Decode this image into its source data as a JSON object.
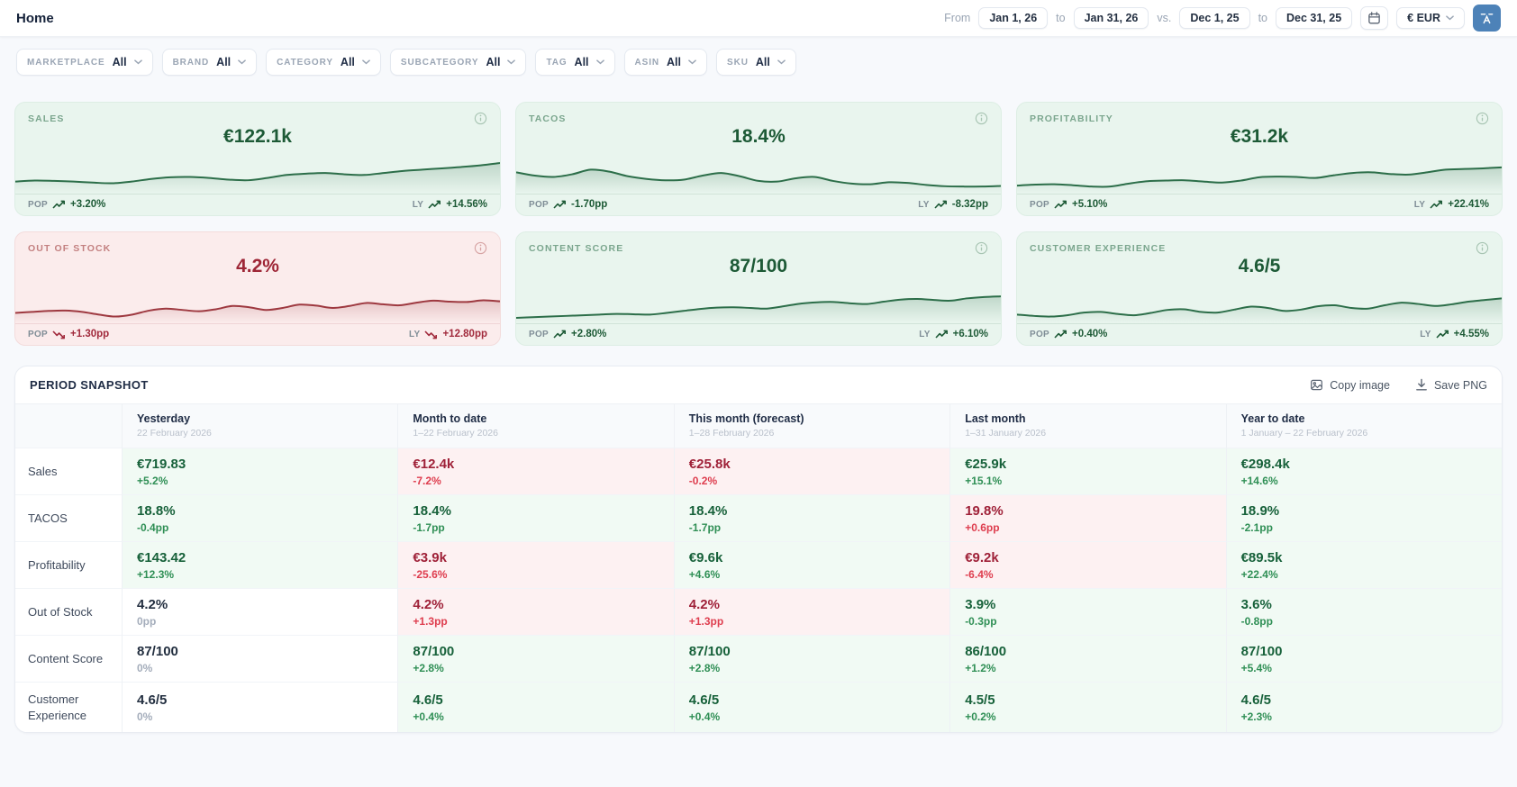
{
  "page": {
    "title": "Home"
  },
  "topbar": {
    "from_label": "From",
    "to_label": "to",
    "vs_label": "vs.",
    "date_start": "Jan 1, 26",
    "date_end": "Jan 31, 26",
    "compare_start": "Dec 1, 25",
    "compare_end": "Dec 31, 25",
    "currency": "€ EUR"
  },
  "colors": {
    "accent_blue": "#4d82b8",
    "positive_dark": "#17613a",
    "positive": "#2f8f55",
    "negative_dark": "#9f2138",
    "negative": "#de3d4e"
  },
  "filters": [
    {
      "label": "MARKETPLACE",
      "value": "All"
    },
    {
      "label": "BRAND",
      "value": "All"
    },
    {
      "label": "CATEGORY",
      "value": "All"
    },
    {
      "label": "SUBCATEGORY",
      "value": "All"
    },
    {
      "label": "TAG",
      "value": "All"
    },
    {
      "label": "ASIN",
      "value": "All"
    },
    {
      "label": "SKU",
      "value": "All"
    }
  ],
  "kpi_labels": {
    "pop": "POP",
    "ly": "LY"
  },
  "kpi_cards": [
    {
      "title": "SALES",
      "value": "€122.1k",
      "pop": "+3.20%",
      "ly": "+14.56%",
      "tone": "green",
      "trend_icon": "trending-up",
      "line_color": "#2c6e49",
      "sparkline": [
        30,
        33,
        32,
        30,
        27,
        25,
        30,
        38,
        43,
        44,
        41,
        36,
        34,
        41,
        50,
        54,
        56,
        52,
        50,
        56,
        62,
        66,
        70,
        74,
        79,
        86
      ]
    },
    {
      "title": "TACOS",
      "value": "18.4%",
      "pop": "-1.70pp",
      "ly": "-8.32pp",
      "tone": "green",
      "trend_icon": "trending-up",
      "line_color": "#2c6e49",
      "sparkline": [
        58,
        48,
        44,
        52,
        66,
        60,
        46,
        38,
        34,
        36,
        48,
        56,
        46,
        32,
        30,
        40,
        44,
        32,
        24,
        22,
        28,
        26,
        20,
        16,
        15,
        15,
        17
      ]
    },
    {
      "title": "PROFITABILITY",
      "value": "€31.2k",
      "pop": "+5.10%",
      "ly": "+22.41%",
      "tone": "green",
      "trend_icon": "trending-up",
      "line_color": "#2c6e49",
      "sparkline": [
        18,
        21,
        22,
        19,
        15,
        15,
        24,
        31,
        33,
        34,
        30,
        27,
        33,
        43,
        45,
        44,
        41,
        49,
        56,
        58,
        53,
        51,
        58,
        66,
        68,
        70,
        73
      ]
    },
    {
      "title": "OUT OF STOCK",
      "value": "4.2%",
      "pop": "+1.30pp",
      "ly": "+12.80pp",
      "tone": "red",
      "trend_icon": "trending-down",
      "line_color": "#9e3940",
      "sparkline": [
        25,
        28,
        31,
        32,
        28,
        20,
        14,
        20,
        32,
        38,
        34,
        30,
        36,
        46,
        42,
        34,
        40,
        50,
        47,
        40,
        46,
        55,
        51,
        48,
        56,
        62,
        59,
        58,
        63,
        60
      ]
    },
    {
      "title": "CONTENT SCORE",
      "value": "87/100",
      "pop": "+2.80%",
      "ly": "+6.10%",
      "tone": "green",
      "trend_icon": "trending-up",
      "line_color": "#2c6e49",
      "sparkline": [
        10,
        12,
        14,
        16,
        18,
        20,
        22,
        21,
        20,
        25,
        31,
        37,
        41,
        42,
        40,
        38,
        45,
        53,
        57,
        58,
        54,
        52,
        59,
        65,
        67,
        64,
        62,
        69,
        73,
        75
      ]
    },
    {
      "title": "CUSTOMER EXPERIENCE",
      "value": "4.6/5",
      "pop": "+0.40%",
      "ly": "+4.55%",
      "tone": "green",
      "trend_icon": "trending-up",
      "line_color": "#2c6e49",
      "sparkline": [
        20,
        16,
        14,
        18,
        26,
        28,
        22,
        18,
        25,
        34,
        36,
        28,
        26,
        35,
        44,
        40,
        31,
        35,
        45,
        48,
        40,
        38,
        48,
        56,
        52,
        46,
        51,
        59,
        64,
        69
      ]
    }
  ],
  "snapshot": {
    "title": "PERIOD SNAPSHOT",
    "copy_image_label": "Copy image",
    "save_png_label": "Save PNG",
    "columns": [
      {
        "label": "Yesterday",
        "range": "22 February 2026"
      },
      {
        "label": "Month to date",
        "range": "1–22 February 2026"
      },
      {
        "label": "This month (forecast)",
        "range": "1–28 February 2026"
      },
      {
        "label": "Last month",
        "range": "1–31 January 2026"
      },
      {
        "label": "Year to date",
        "range": "1 January – 22 February 2026"
      }
    ],
    "rows": [
      {
        "label": "Sales",
        "cells": [
          {
            "value": "€719.83",
            "delta": "+5.2%",
            "tone": "up"
          },
          {
            "value": "€12.4k",
            "delta": "-7.2%",
            "tone": "down"
          },
          {
            "value": "€25.8k",
            "delta": "-0.2%",
            "tone": "down"
          },
          {
            "value": "€25.9k",
            "delta": "+15.1%",
            "tone": "up"
          },
          {
            "value": "€298.4k",
            "delta": "+14.6%",
            "tone": "up"
          }
        ]
      },
      {
        "label": "TACOS",
        "cells": [
          {
            "value": "18.8%",
            "delta": "-0.4pp",
            "tone": "up"
          },
          {
            "value": "18.4%",
            "delta": "-1.7pp",
            "tone": "up"
          },
          {
            "value": "18.4%",
            "delta": "-1.7pp",
            "tone": "up"
          },
          {
            "value": "19.8%",
            "delta": "+0.6pp",
            "tone": "down"
          },
          {
            "value": "18.9%",
            "delta": "-2.1pp",
            "tone": "up"
          }
        ]
      },
      {
        "label": "Profitability",
        "cells": [
          {
            "value": "€143.42",
            "delta": "+12.3%",
            "tone": "up"
          },
          {
            "value": "€3.9k",
            "delta": "-25.6%",
            "tone": "down"
          },
          {
            "value": "€9.6k",
            "delta": "+4.6%",
            "tone": "up"
          },
          {
            "value": "€9.2k",
            "delta": "-6.4%",
            "tone": "down"
          },
          {
            "value": "€89.5k",
            "delta": "+22.4%",
            "tone": "up"
          }
        ]
      },
      {
        "label": "Out of Stock",
        "cells": [
          {
            "value": "4.2%",
            "delta": "0pp",
            "tone": "flat"
          },
          {
            "value": "4.2%",
            "delta": "+1.3pp",
            "tone": "down"
          },
          {
            "value": "4.2%",
            "delta": "+1.3pp",
            "tone": "down"
          },
          {
            "value": "3.9%",
            "delta": "-0.3pp",
            "tone": "up"
          },
          {
            "value": "3.6%",
            "delta": "-0.8pp",
            "tone": "up"
          }
        ]
      },
      {
        "label": "Content Score",
        "cells": [
          {
            "value": "87/100",
            "delta": "0%",
            "tone": "flat"
          },
          {
            "value": "87/100",
            "delta": "+2.8%",
            "tone": "up"
          },
          {
            "value": "87/100",
            "delta": "+2.8%",
            "tone": "up"
          },
          {
            "value": "86/100",
            "delta": "+1.2%",
            "tone": "up"
          },
          {
            "value": "87/100",
            "delta": "+5.4%",
            "tone": "up"
          }
        ]
      },
      {
        "label": "Customer Experience",
        "cells": [
          {
            "value": "4.6/5",
            "delta": "0%",
            "tone": "flat"
          },
          {
            "value": "4.6/5",
            "delta": "+0.4%",
            "tone": "up"
          },
          {
            "value": "4.6/5",
            "delta": "+0.4%",
            "tone": "up"
          },
          {
            "value": "4.5/5",
            "delta": "+0.2%",
            "tone": "up"
          },
          {
            "value": "4.6/5",
            "delta": "+2.3%",
            "tone": "up"
          }
        ]
      }
    ]
  }
}
